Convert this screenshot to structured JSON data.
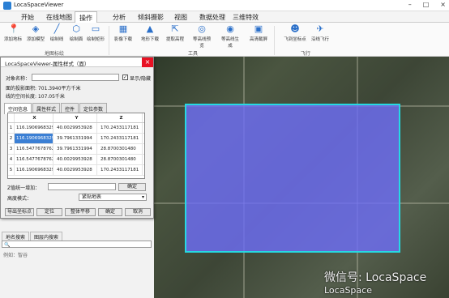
{
  "app": {
    "title": "LocaSpaceViewer"
  },
  "menu": {
    "tabs": [
      "开始",
      "在线地图",
      "操作",
      "分析",
      "倾斜摄影",
      "视图",
      "数据处理",
      "三维特效"
    ],
    "active": "操作"
  },
  "ribbon": {
    "tools": [
      {
        "label": "添加地标",
        "icon": "pin-icon"
      },
      {
        "label": "添加模型",
        "icon": "cube-icon"
      },
      {
        "label": "绘制线",
        "icon": "line-icon"
      },
      {
        "label": "绘制面",
        "icon": "polygon-icon"
      },
      {
        "label": "绘制矩形",
        "icon": "rect-icon"
      },
      {
        "label": "影像下载",
        "icon": "image-icon"
      },
      {
        "label": "地形下载",
        "icon": "terrain-icon"
      },
      {
        "label": "提取高程",
        "icon": "elevation-icon"
      },
      {
        "label": "等高线预览",
        "icon": "contour-icon"
      },
      {
        "label": "等高线生成",
        "icon": "contour-gen-icon"
      },
      {
        "label": "高清截屏",
        "icon": "screenshot-icon"
      },
      {
        "label": "飞到坐标点",
        "icon": "person-icon"
      },
      {
        "label": "沿线飞行",
        "icon": "fly-icon"
      }
    ],
    "groups": [
      "地图标绘",
      "工具",
      "飞行"
    ]
  },
  "dialog": {
    "title": "LocaSpaceViewer-属性样式（面）",
    "close": "×",
    "name_label": "对象名称：",
    "show_hide": "显示/隐藏",
    "area_label": "面的投影面积: 701.3940平方千米",
    "perimeter_label": "线的空间长度: 107.05千米",
    "tabs": [
      "空间信息",
      "属性样式",
      "控件",
      "定位参数"
    ],
    "table": {
      "headers": [
        "",
        "X",
        "Y",
        "Z"
      ],
      "rows": [
        [
          "1",
          "116.1906968329",
          "40.0029953928",
          "170.2433117181"
        ],
        [
          "2",
          "116.1906968329",
          "39.7961331994",
          "170.2433117181"
        ],
        [
          "3",
          "116.5477678762",
          "39.7961331994",
          "28.8700301480"
        ],
        [
          "4",
          "116.5477678762",
          "40.0029953928",
          "28.8700301480"
        ],
        [
          "5",
          "116.1906968329",
          "40.0029953928",
          "170.2433117181"
        ]
      ]
    },
    "z_increase_label": "Z值统一增加：",
    "confirm": "确定",
    "height_mode_label": "高度模式：",
    "height_mode": "紧贴地表",
    "buttons": [
      "导出坐标点",
      "定位",
      "整体平移",
      "确定",
      "取消"
    ]
  },
  "left": {
    "search_tabs": [
      "地名搜索",
      "图层内搜索"
    ],
    "example": "例如：智谷"
  },
  "watermark": {
    "line1": "微信号: LocaSpace",
    "line2": "LocaSpace"
  },
  "map": {
    "polygon_fill": "#6e6ef5",
    "polygon_stroke": "#26d9e3"
  }
}
